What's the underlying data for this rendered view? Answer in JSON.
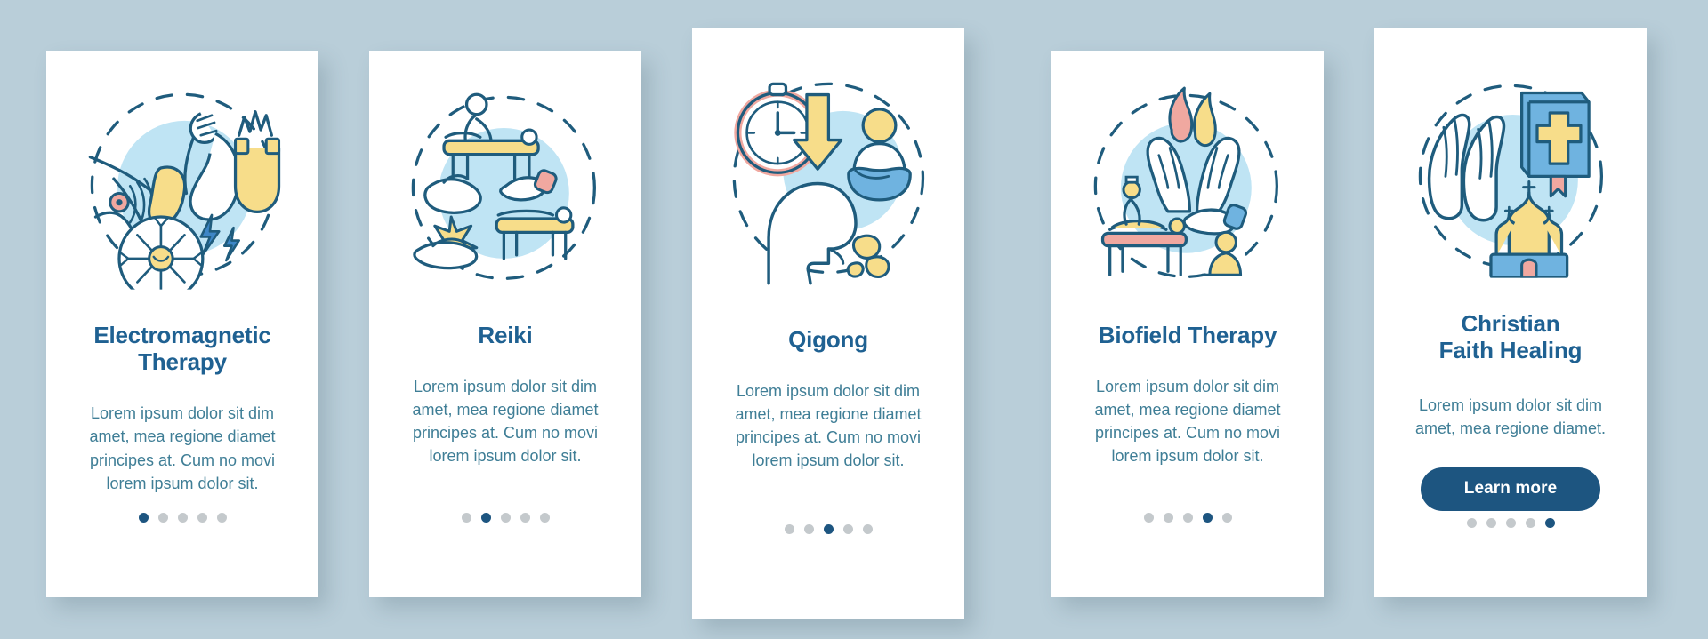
{
  "theme": {
    "background": "#b9ced9",
    "card_background": "#ffffff",
    "title_color": "#1f6192",
    "body_color": "#3f7e96",
    "accent_dark": "#1d5580",
    "dot_inactive": "#c4c9cc",
    "illustration_blue": "#bfe4f4",
    "illustration_yellow": "#f7dd8a",
    "illustration_pink": "#f0a8a0",
    "illustration_stroke": "#1f5c7d"
  },
  "cards": [
    {
      "title": "Electromagnetic Therapy",
      "title_lines": [
        "Electromagnetic",
        "Therapy"
      ],
      "body": "Lorem ipsum dolor sit dim amet, mea regione diamet principes at. Cum no movi lorem ipsum dolor sit.",
      "illustration": "electromagnetic-therapy-illustration",
      "dots": {
        "count": 5,
        "active_index": 0
      },
      "has_button": false
    },
    {
      "title": "Reiki",
      "title_lines": [
        "Reiki"
      ],
      "body": "Lorem ipsum dolor sit dim amet, mea regione diamet principes at. Cum no movi lorem ipsum dolor sit.",
      "illustration": "reiki-illustration",
      "dots": {
        "count": 5,
        "active_index": 1
      },
      "has_button": false
    },
    {
      "title": "Qigong",
      "title_lines": [
        "Qigong"
      ],
      "body": "Lorem ipsum dolor sit dim amet, mea regione diamet principes at. Cum no movi lorem ipsum dolor sit.",
      "illustration": "qigong-illustration",
      "dots": {
        "count": 5,
        "active_index": 2
      },
      "has_button": false
    },
    {
      "title": "Biofield Therapy",
      "title_lines": [
        "Biofield Therapy"
      ],
      "body": "Lorem ipsum dolor sit dim amet, mea regione diamet principes at. Cum no movi lorem ipsum dolor sit.",
      "illustration": "biofield-therapy-illustration",
      "dots": {
        "count": 5,
        "active_index": 3
      },
      "has_button": false
    },
    {
      "title": "Christian Faith Healing",
      "title_lines": [
        "Christian",
        "Faith Healing"
      ],
      "body": "Lorem ipsum dolor sit dim amet, mea regione diamet.",
      "illustration": "christian-faith-healing-illustration",
      "dots": {
        "count": 5,
        "active_index": 4
      },
      "has_button": true,
      "button_label": "Learn more"
    }
  ]
}
